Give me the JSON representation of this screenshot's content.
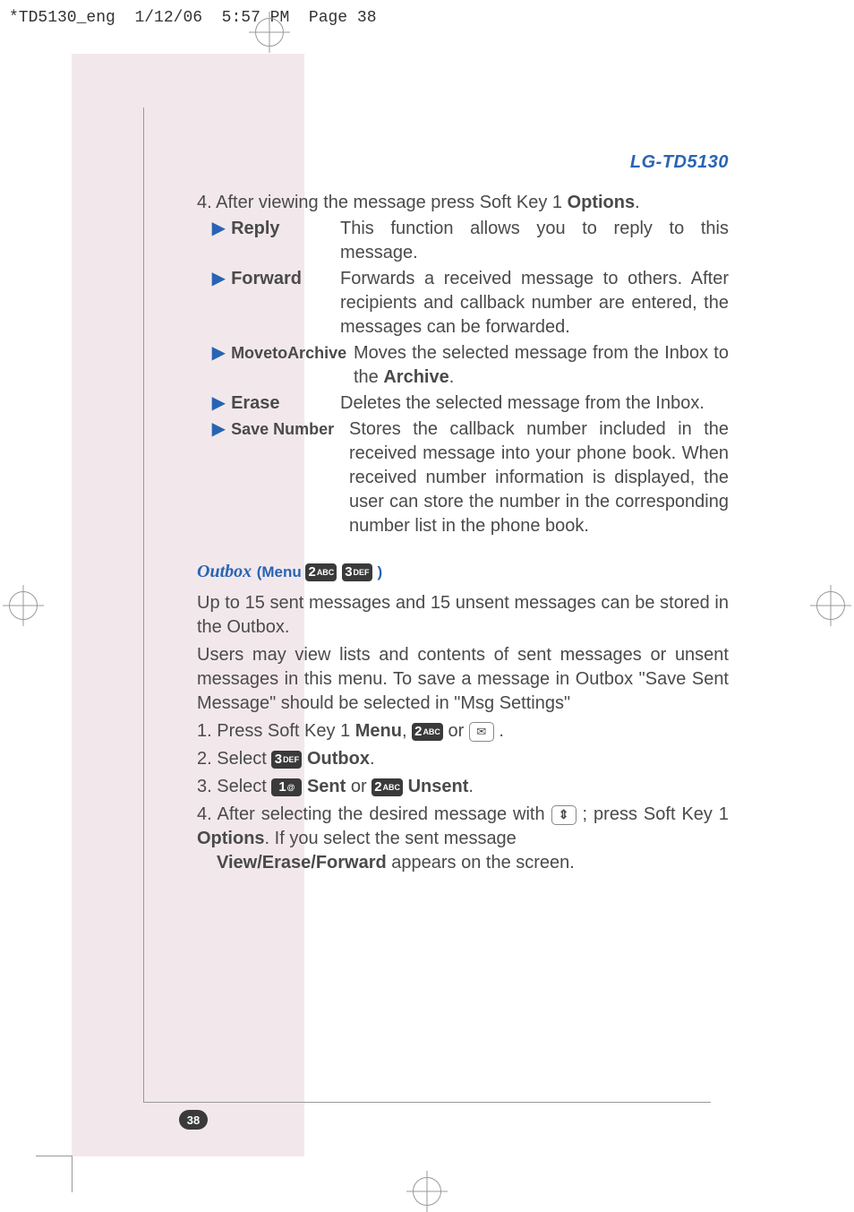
{
  "header": {
    "filename": "*TD5130_eng",
    "date": "1/12/06",
    "time": "5:57 PM",
    "page_label": "Page 38"
  },
  "brand": "LG-TD5130",
  "intro": {
    "number": "4.",
    "text_a": "After viewing the message press Soft Key 1 ",
    "text_b": "Options",
    "text_c": "."
  },
  "options": [
    {
      "label": "Reply",
      "desc": "This function allows you to reply to this message."
    },
    {
      "label": "Forward",
      "desc": "Forwards a received message to others. After recipients and callback number are entered, the messages can be forwarded."
    },
    {
      "label": "MovetoArchive",
      "desc_a": "Moves the selected message from the Inbox to the ",
      "desc_b": "Archive",
      "desc_c": "."
    },
    {
      "label": "Erase",
      "desc": "Deletes the selected message from the Inbox."
    },
    {
      "label": "Save Number",
      "desc": "Stores the callback number included in the received message into your phone book. When received number information is displayed, the user can store the number in the corresponding number list in the phone book."
    }
  ],
  "outbox": {
    "title": "Outbox",
    "menu_prefix": "(Menu ",
    "menu_suffix": " )",
    "para1": "Up to 15 sent messages and 15 unsent messages can be stored in the Outbox.",
    "para2": "Users may view lists and contents of sent messages or unsent messages in this menu. To save a message in Outbox \"Save Sent Message\" should be selected in \"Msg Settings\"",
    "steps": {
      "s1a": "1. Press Soft Key 1 ",
      "s1b": "Menu",
      "s1c": ", ",
      "s1d": " or ",
      "s1e": " .",
      "s2a": "2. Select ",
      "s2b": " ",
      "s2c": "Outbox",
      "s2d": ".",
      "s3a": "3. Select ",
      "s3b": " ",
      "s3c": "Sent",
      "s3d": " or ",
      "s3e": " ",
      "s3f": "Unsent",
      "s3g": ".",
      "s4a": "4. After selecting the desired message with ",
      "s4b": " ; press Soft Key 1 ",
      "s4c": "Options",
      "s4d": ". If you select the sent message ",
      "s4e": "View/Erase/Forward",
      "s4f": " appears on the screen."
    }
  },
  "keys": {
    "k1_num": "1",
    "k1_sub": "@",
    "k2_num": "2",
    "k2_sub": "ABC",
    "k3_num": "3",
    "k3_sub": "DEF"
  },
  "page_number": "38"
}
